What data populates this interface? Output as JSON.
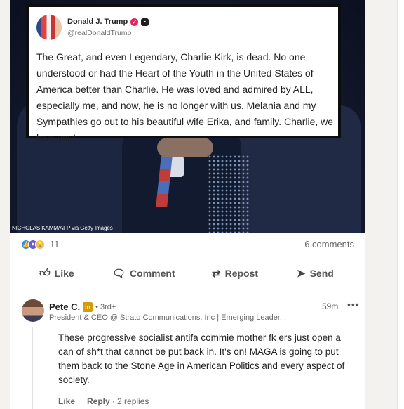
{
  "post": {
    "image_credit": "NICHOLAS KAMM/AFP via Getty Images",
    "tweet": {
      "name": "Donald J. Trump",
      "handle": "@realDonaldTrump",
      "text": "The Great, and even Legendary, Charlie Kirk, is dead. No one understood or had the Heart of the Youth in the United States of America better than Charlie. He was loved and admired by ALL, especially me, and now, he is no longer with us. Melania and my Sympathies go out to his beautiful wife Erika, and family. Charlie, we love you!"
    },
    "reaction_count": "11",
    "comments_count": "6 comments",
    "actions": {
      "like": "Like",
      "comment": "Comment",
      "repost": "Repost",
      "send": "Send"
    }
  },
  "comment": {
    "author": "Pete C.",
    "badge": "in",
    "degree": "• 3rd+",
    "title": "President & CEO @ Strato Communications, Inc | Emerging Leader...",
    "time": "59m",
    "more": "•••",
    "body": "These progressive socialist antifa commie mother fk ers just open a can of sh*t that cannot be put back in. It's on! MAGA is going to put them back to the Stone Age in American Politics and every aspect of society.",
    "like_label": "Like",
    "reply_label": "Reply",
    "replies": "· 2 replies"
  },
  "icons": {
    "like": "thumbs-up-icon",
    "comment": "comment-icon",
    "repost": "repost-icon",
    "send": "send-icon"
  }
}
